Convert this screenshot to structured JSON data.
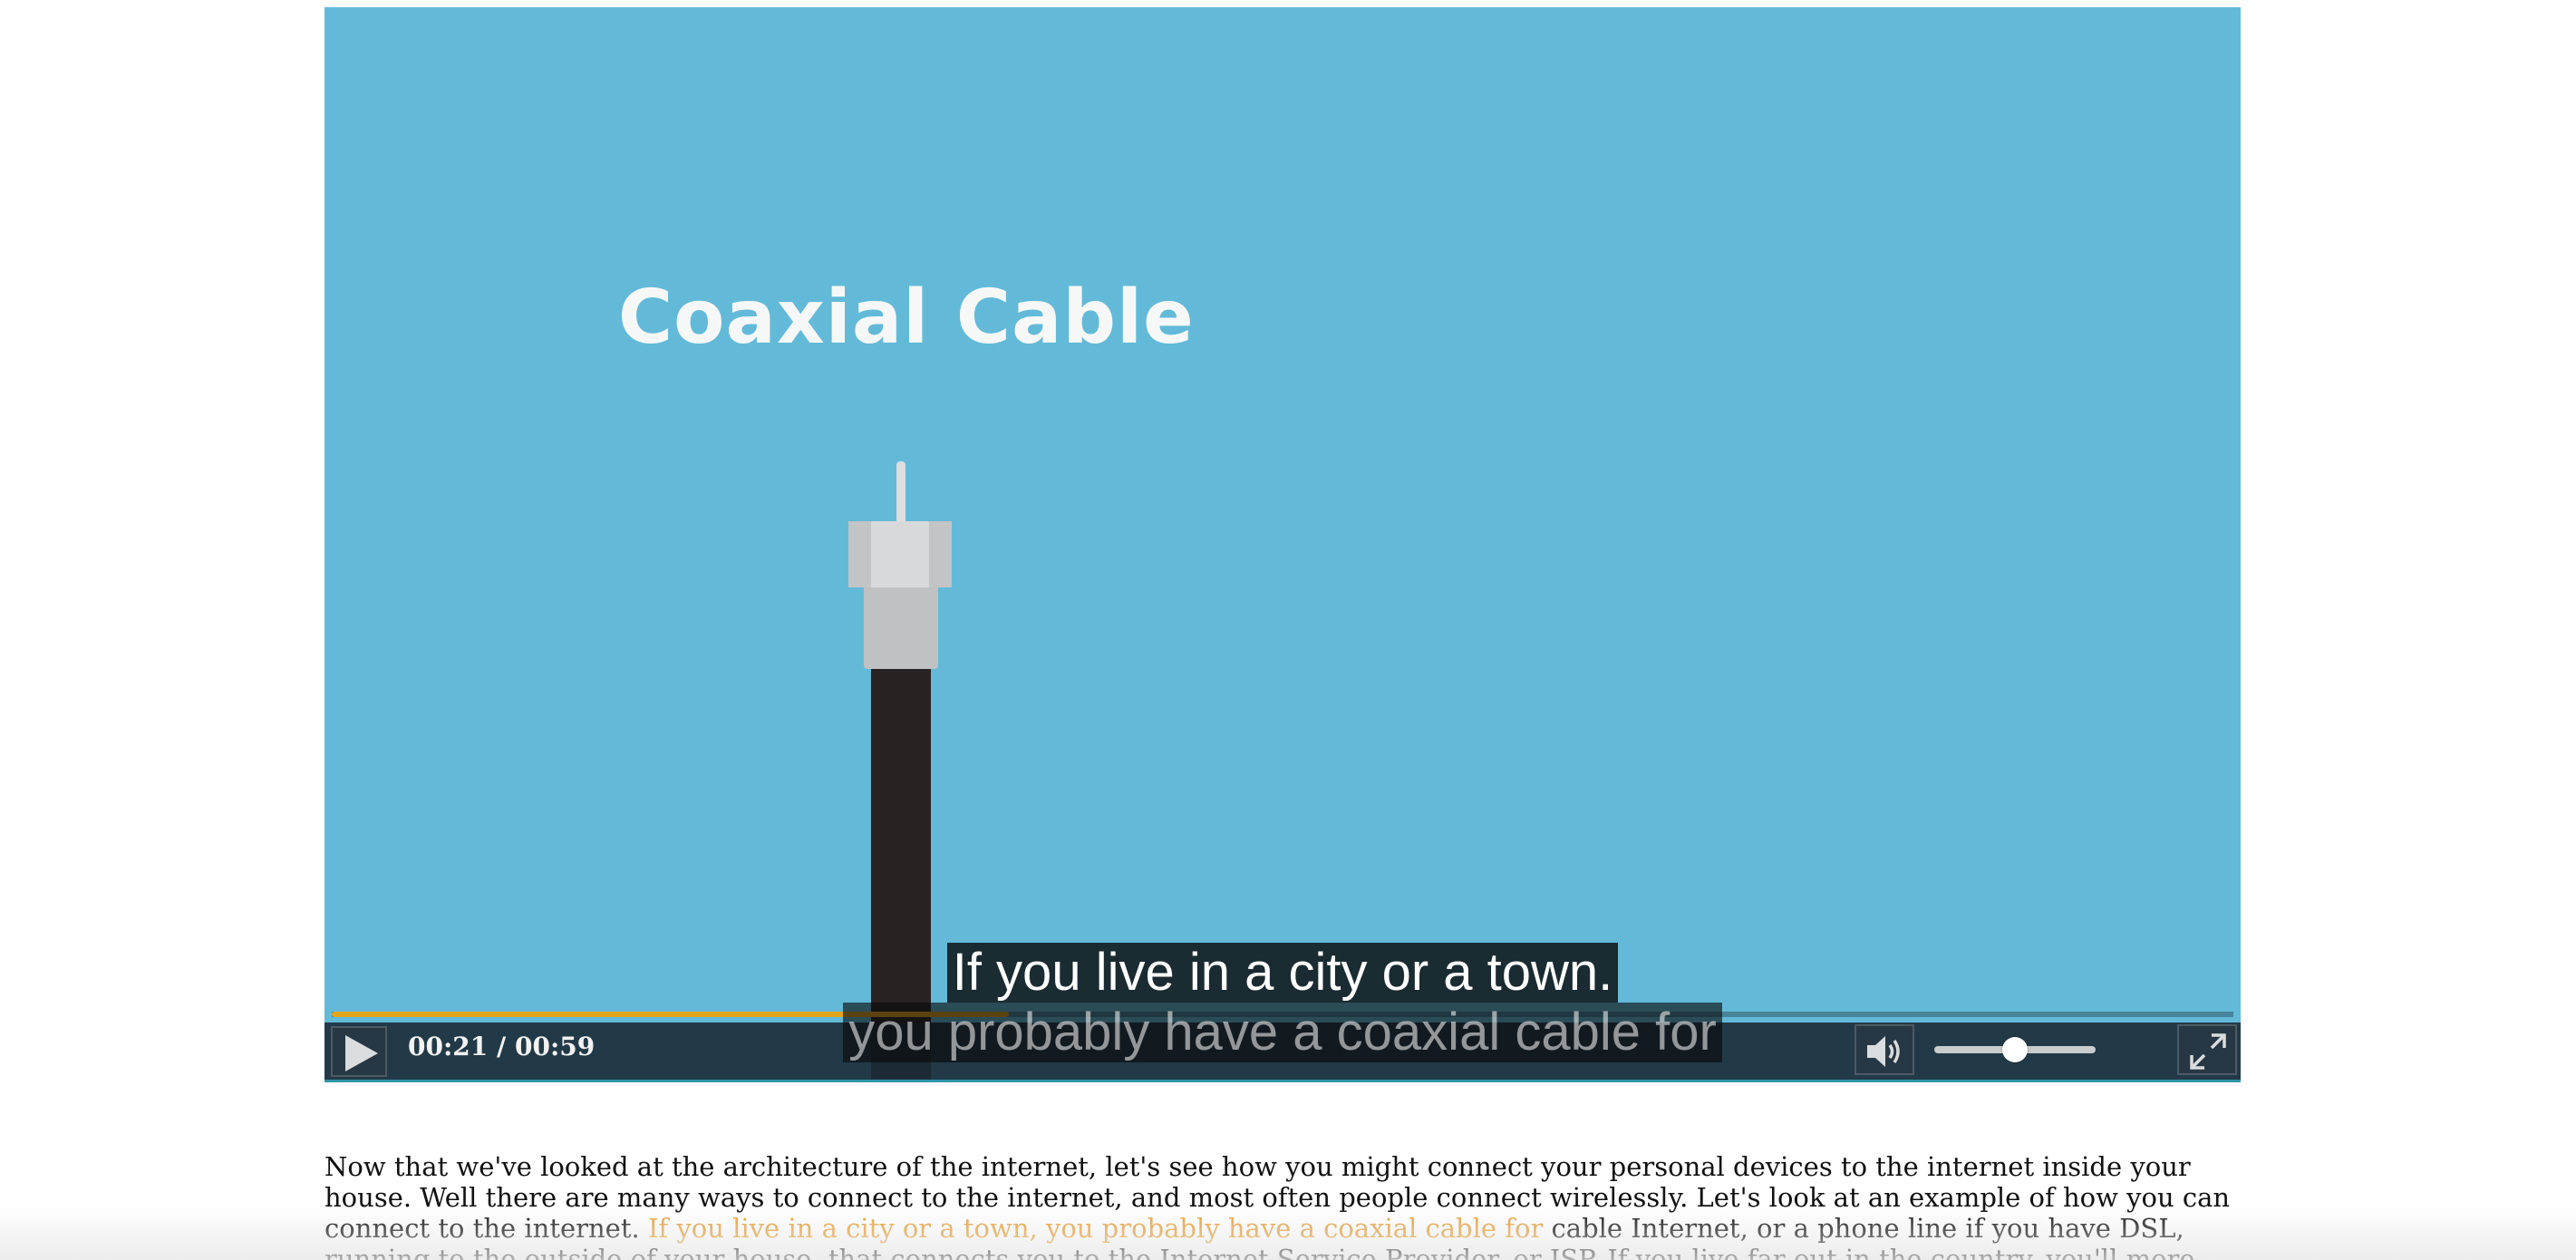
{
  "video": {
    "slide_title": "Coaxial Cable",
    "captions": [
      "If you live in a city or a town.",
      "you probably have a coaxial cable for"
    ],
    "controls": {
      "play_icon": "play-icon",
      "time_display": "00:21 / 00:59",
      "progress_fraction": 0.356,
      "volume_icon": "volume-icon",
      "volume_fraction": 0.5,
      "fullscreen_icon": "fullscreen-icon"
    },
    "colors": {
      "background": "#63bad8",
      "progress": "#e3a41d",
      "control_bar": "#1b2b37"
    }
  },
  "transcript": {
    "intro": "Now that we've looked at the architecture of the internet, let's see how you might connect your personal devices to the internet inside your house. Well there are many ways to connect to the internet, and most often people connect wirelessly. Let's look at an example of how you can connect to the internet.",
    "highlight": "If you live in a city or a town, you probably have a coaxial cable for",
    "rest": "cable Internet, or a phone line if you have DSL, running to the outside of your house, that connects you to the Internet Service Provider, or ISP. If you live far out in the country, you'll more likely have a dish outside your house, connecting",
    "highlight_color": "#e8a13c"
  }
}
